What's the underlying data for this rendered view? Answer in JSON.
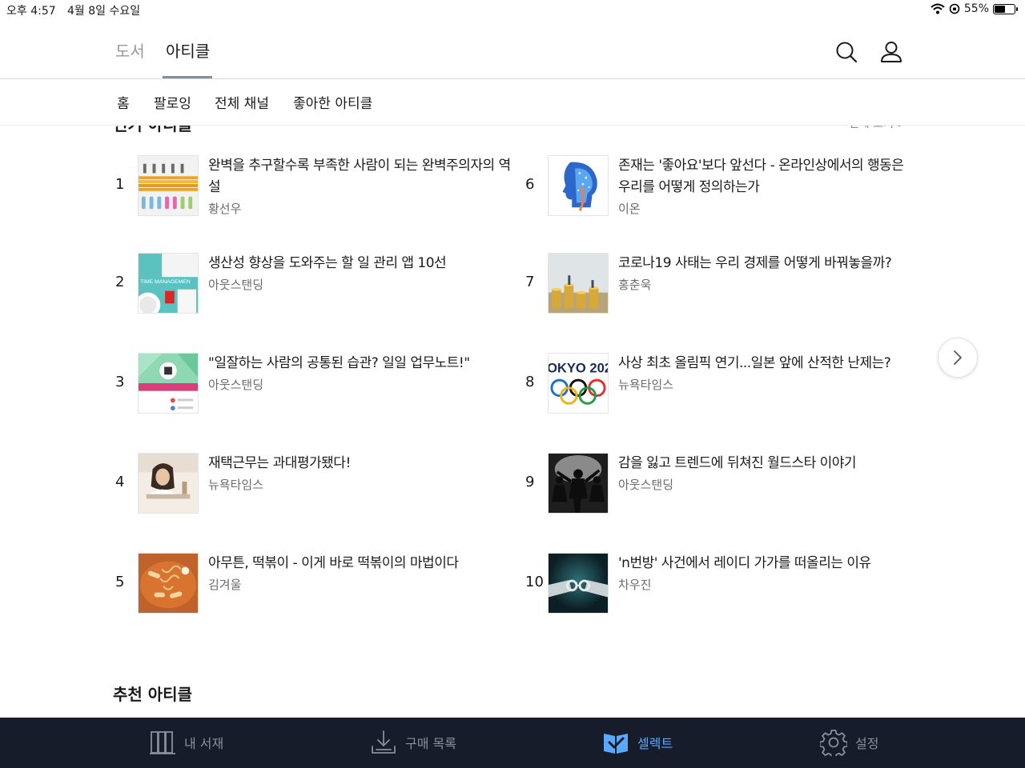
{
  "status_bar": {
    "time": "오후 4:57",
    "date": "4월 8일 수요일",
    "battery": "55%",
    "battery_level": 0.55
  },
  "top_nav": {
    "tabs": [
      {
        "label": "도서",
        "active": false
      },
      {
        "label": "아티클",
        "active": true
      }
    ]
  },
  "sub_nav": {
    "items": [
      "홈",
      "팔로잉",
      "전체 채널",
      "좋아한 아티클"
    ]
  },
  "popular": {
    "title_peek": "인기 아티클",
    "see_all": "전체 보기 >",
    "items": [
      {
        "rank": "1",
        "title": "완벽을 추구할수록 부족한 사람이 되는 완벽주의자의 역설",
        "author": "황선우",
        "thumb": "pencils-thumb"
      },
      {
        "rank": "2",
        "title": "생산성 향상을 도와주는 할 일 관리 앱 10선",
        "author": "아웃스탠딩",
        "thumb": "time-management-thumb",
        "thumb_text": "TIME MANAGEMEN"
      },
      {
        "rank": "3",
        "title": "\"일잘하는 사람의 공통된 습관? 일일 업무노트!\"",
        "author": "아웃스탠딩",
        "thumb": "evernote-thumb"
      },
      {
        "rank": "4",
        "title": "재택근무는 과대평가됐다!",
        "author": "뉴욕타임스",
        "thumb": "woman-thumb"
      },
      {
        "rank": "5",
        "title": "아무튼, 떡볶이 - 이게 바로 떡볶이의 마법이다",
        "author": "김겨울",
        "thumb": "tteokbokki-thumb"
      },
      {
        "rank": "6",
        "title": "존재는 '좋아요'보다 앞선다 - 온라인상에서의 행동은 우리를 어떻게 정의하는가",
        "author": "이온",
        "thumb": "digital-head-thumb"
      },
      {
        "rank": "7",
        "title": "코로나19 사태는 우리 경제를 어떻게 바꿔놓을까?",
        "author": "홍춘욱",
        "thumb": "coins-thumb"
      },
      {
        "rank": "8",
        "title": "사상 최초 올림픽 연기...일본 앞에 산적한 난제는?",
        "author": "뉴욕타임스",
        "thumb": "olympic-thumb",
        "thumb_text": "OKYO 202"
      },
      {
        "rank": "9",
        "title": "감을 잃고 트렌드에 뒤쳐진 월드스타 이야기",
        "author": "아웃스탠딩",
        "thumb": "dancers-thumb"
      },
      {
        "rank": "10",
        "title": "'n번방' 사건에서 레이디 가가를 떠올리는 이유",
        "author": "차우진",
        "thumb": "handcuffs-thumb"
      }
    ]
  },
  "recommended": {
    "title": "추천 아티클"
  },
  "bottom_nav": {
    "items": [
      {
        "label": "내 서재",
        "icon": "library-icon",
        "active": false
      },
      {
        "label": "구매 목록",
        "icon": "download-icon",
        "active": false
      },
      {
        "label": "셀렉트",
        "icon": "select-book-icon",
        "active": true
      },
      {
        "label": "설정",
        "icon": "gear-icon",
        "active": false
      }
    ]
  },
  "colors": {
    "bottom_bar_bg": "#161c2a",
    "active_accent": "#5aa8ff",
    "inactive_tab": "#9a9a9a"
  }
}
